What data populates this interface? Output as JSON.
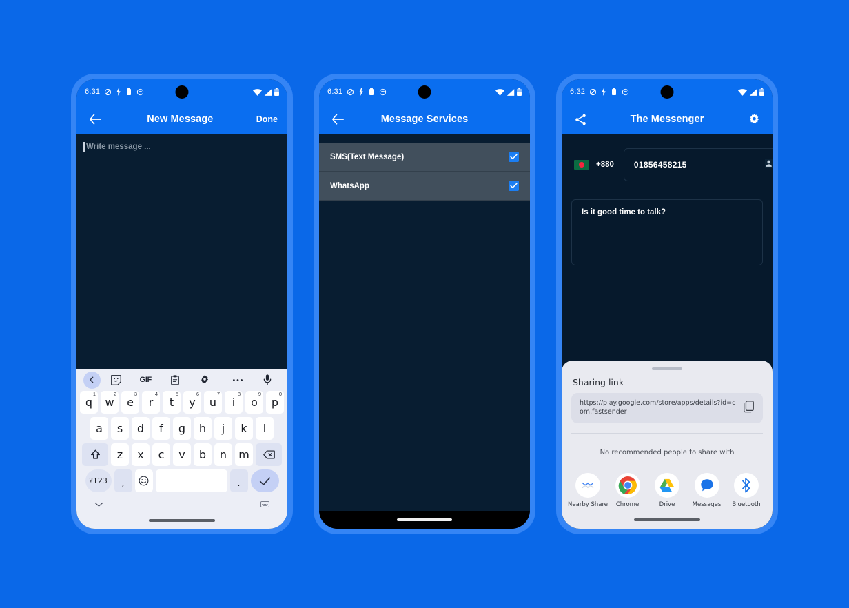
{
  "background_color": "#0a68e8",
  "bezel_color": "#3585f5",
  "accent_color": "#0a6ef0",
  "screen_bg": "#06192c",
  "phones": [
    {
      "status": {
        "time": "6:31",
        "icons": [
          "do-not-disturb-icon",
          "flash-icon",
          "vibrate-icon",
          "clock-icon"
        ],
        "right_icons": [
          "wifi-icon",
          "cellular-icon",
          "battery-icon"
        ]
      },
      "appbar": {
        "back": "back-arrow-icon",
        "title": "New Message",
        "action": "Done"
      },
      "compose": {
        "placeholder": "Write message ..."
      },
      "keyboard": {
        "toolbar": [
          "back-chevron-icon",
          "sticker-icon",
          "GIF",
          "clipboard-icon",
          "gear-icon",
          "more-icon",
          "mic-icon"
        ],
        "row1": [
          {
            "k": "q",
            "n": "1"
          },
          {
            "k": "w",
            "n": "2"
          },
          {
            "k": "e",
            "n": "3"
          },
          {
            "k": "r",
            "n": "4"
          },
          {
            "k": "t",
            "n": "5"
          },
          {
            "k": "y",
            "n": "6"
          },
          {
            "k": "u",
            "n": "7"
          },
          {
            "k": "i",
            "n": "8"
          },
          {
            "k": "o",
            "n": "9"
          },
          {
            "k": "p",
            "n": "0"
          }
        ],
        "row2": [
          "a",
          "s",
          "d",
          "f",
          "g",
          "h",
          "j",
          "k",
          "l"
        ],
        "row3": [
          "z",
          "x",
          "c",
          "v",
          "b",
          "n",
          "m"
        ],
        "shift": "shift-icon",
        "backspace": "backspace-icon",
        "sym": "?123",
        "comma": ",",
        "emoji": "emoji-icon",
        "space": "",
        "period": ".",
        "enter": "check-icon",
        "collapse": "chevron-down-icon",
        "switch": "keyboard-switch-icon"
      }
    },
    {
      "status": {
        "time": "6:31"
      },
      "appbar": {
        "back": "back-arrow-icon",
        "title": "Message Services"
      },
      "services": [
        {
          "label": "SMS(Text Message)",
          "checked": true
        },
        {
          "label": "WhatsApp",
          "checked": true
        }
      ]
    },
    {
      "status": {
        "time": "6:32"
      },
      "appbar": {
        "share": "share-icon",
        "title": "The Messenger",
        "settings": "gear-icon"
      },
      "phone_entry": {
        "flag": "bangladesh-flag-icon",
        "country_code": "+880",
        "number": "01856458215",
        "contacts_icon": "contacts-icon"
      },
      "message": {
        "text": "Is it good time to talk?"
      },
      "share_sheet": {
        "title": "Sharing link",
        "url": "https://play.google.com/store/apps/details?id=com.fastsender",
        "copy_icon": "copy-icon",
        "no_recommend": "No recommended people to share with",
        "apps": [
          {
            "label": "Nearby Share",
            "icon": "nearby-share-icon"
          },
          {
            "label": "Chrome",
            "icon": "chrome-icon"
          },
          {
            "label": "Drive",
            "icon": "drive-icon"
          },
          {
            "label": "Messages",
            "icon": "messages-icon"
          },
          {
            "label": "Bluetooth",
            "icon": "bluetooth-icon"
          }
        ]
      }
    }
  ]
}
